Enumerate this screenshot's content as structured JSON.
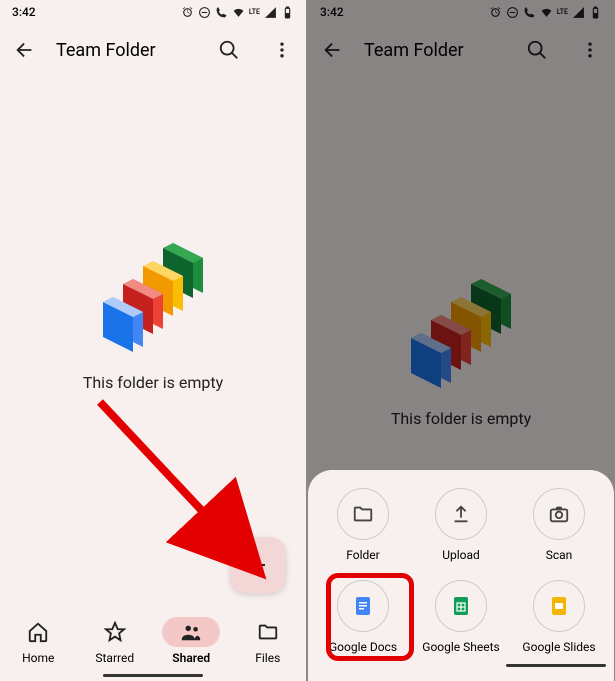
{
  "status": {
    "time": "3:42",
    "network_label": "LTE"
  },
  "appbar": {
    "title": "Team Folder"
  },
  "empty": {
    "message": "This folder is empty"
  },
  "nav": {
    "home": "Home",
    "starred": "Starred",
    "shared": "Shared",
    "files": "Files"
  },
  "sheet": {
    "folder": "Folder",
    "upload": "Upload",
    "scan": "Scan",
    "docs": "Google Docs",
    "sheets": "Google Sheets",
    "slides": "Google Slides"
  }
}
